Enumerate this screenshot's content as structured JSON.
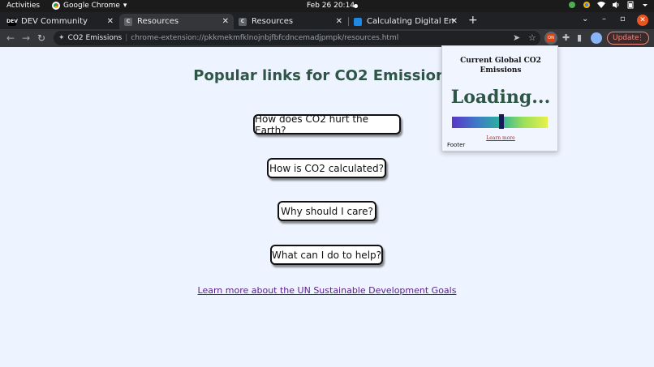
{
  "system_bar": {
    "activities": "Activities",
    "app_name": "Google Chrome",
    "app_caret": "▾",
    "clock": "Feb 26  20:14"
  },
  "tabs": [
    {
      "favicon_text": "DEV",
      "title": "DEV Community",
      "close": "✕",
      "active": false
    },
    {
      "favicon_text": "C",
      "title": "Resources",
      "close": "✕",
      "active": true
    },
    {
      "favicon_text": "C",
      "title": "Resources",
      "close": "✕",
      "active": false
    },
    {
      "favicon_text": "",
      "title": "Calculating Digital Emissi",
      "close": "✕",
      "active": false
    }
  ],
  "tabstrip_controls": {
    "new_tab": "+",
    "tab_search": "⌄",
    "minimize": "–",
    "maximize": "▫",
    "close": "✕"
  },
  "toolbar": {
    "back": "←",
    "forward": "→",
    "reload": "↻",
    "site_name": "CO2 Emissions",
    "separator": "|",
    "url": "chrome-extension://pkkmekmfklnojnbjfbfcdncemadjpmpk/resources.html",
    "ext_badge": "ON",
    "update_label": "Update",
    "menu_dots": "⋮"
  },
  "page": {
    "title": "Popular links for CO2 Emissions:",
    "links": [
      "How does CO2 hurt the Earth?",
      "How is CO2 calculated?",
      "Why should I care?",
      "What can I do to help?"
    ],
    "un_link": "Learn more about the UN Sustainable Development Goals"
  },
  "popup": {
    "title": "Current Global CO2 Emissions",
    "status": "Loading...",
    "level_fraction": 0.52,
    "learn_more": "Learn more",
    "footer": "Footer"
  },
  "colors": {
    "page_bg": "#eef4ff",
    "title_green": "#2e5647",
    "link_purple": "#5a1f8c",
    "update_red": "#f28b82",
    "learn_more_red": "#b3261e"
  }
}
